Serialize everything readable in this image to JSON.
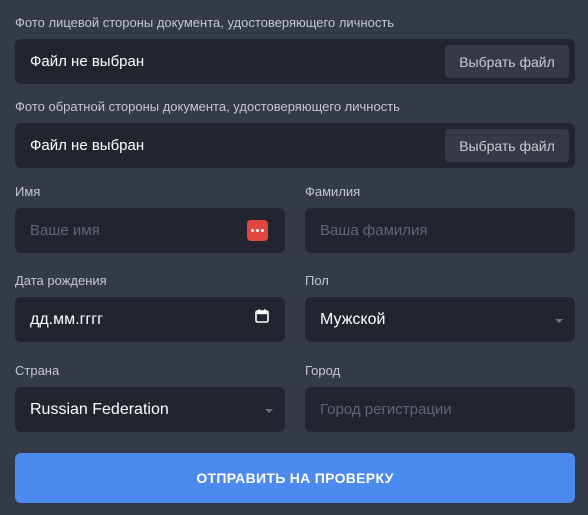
{
  "front_doc": {
    "label": "Фото лицевой стороны документа, удостоверяющего личность",
    "status": "Файл не выбран",
    "button": "Выбрать файл"
  },
  "back_doc": {
    "label": "Фото обратной стороны документа, удостоверяющего личность",
    "status": "Файл не выбран",
    "button": "Выбрать файл"
  },
  "first_name": {
    "label": "Имя",
    "placeholder": "Ваше имя",
    "value": ""
  },
  "last_name": {
    "label": "Фамилия",
    "placeholder": "Ваша фамилия",
    "value": ""
  },
  "birth_date": {
    "label": "Дата рождения",
    "value": "дд.мм.гггг"
  },
  "gender": {
    "label": "Пол",
    "selected": "Мужской"
  },
  "country": {
    "label": "Страна",
    "selected": "Russian Federation"
  },
  "city": {
    "label": "Город",
    "placeholder": "Город регистрации",
    "value": ""
  },
  "submit": {
    "label": "ОТПРАВИТЬ НА ПРОВЕРКУ"
  },
  "icons": {
    "password_manager": "password-manager-icon",
    "calendar": "calendar-icon",
    "dropdown": "chevron-down-icon"
  },
  "colors": {
    "background": "#353a48",
    "field": "#222530",
    "accent": "#4d8af0",
    "password_icon": "#e0473f"
  }
}
